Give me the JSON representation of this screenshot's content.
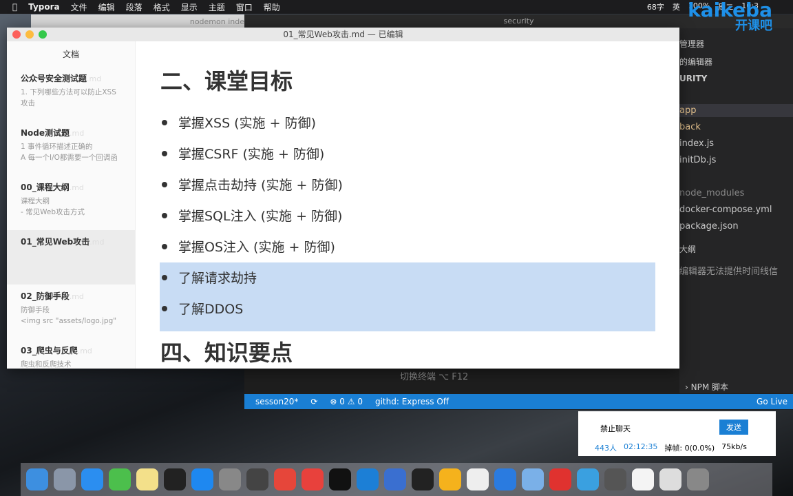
{
  "menubar": {
    "items": [
      "Typora",
      "文件",
      "编辑",
      "段落",
      "格式",
      "显示",
      "主题",
      "窗口",
      "帮助"
    ],
    "right": [
      "68字",
      "英",
      "100%",
      "周二",
      "10:3"
    ]
  },
  "brand": {
    "name": "kaikeba",
    "sub": "开课吧",
    "color": "#1e90e8"
  },
  "nodemon": {
    "title": "nodemon inde"
  },
  "vscode": {
    "title": "security",
    "explorer": [
      "管理器",
      "的编辑器",
      "URITY",
      "app",
      "back",
      "index.js",
      "initDb.js",
      "node_modules",
      "docker-compose.yml",
      "package.json",
      "大纲",
      "编辑器无法提供时间线信"
    ],
    "terminal_hint": "切换终端  ⌥ F12",
    "npm": "› NPM 脚本",
    "status": {
      "branch": "sesson20*",
      "problems": "⊗ 0 ⚠ 0",
      "githd": "githd: Express Off",
      "golive": "Go Live"
    }
  },
  "typora": {
    "title": "01_常见Web攻击.md — 已编辑",
    "sidebar_title": "文档",
    "docs": [
      {
        "name": "公众号安全测试题",
        "ext": ".md",
        "preview": [
          "1. 下列哪些方法可以防止XSS",
          "攻击"
        ]
      },
      {
        "name": "Node测试题",
        "ext": ".md",
        "preview": [
          "1 事件循环描述正确的",
          "A 每一个I/O都需要一个回调函"
        ]
      },
      {
        "name": "00_课程大纲",
        "ext": ".md",
        "preview": [
          "课程大纲",
          "- 常见Web攻击方式"
        ]
      },
      {
        "name": "01_常见Web攻击",
        "ext": ".md",
        "preview": [
          "",
          ""
        ]
      },
      {
        "name": "02_防御手段",
        "ext": ".md",
        "preview": [
          "防御手段",
          "<img src \"assets/logo.jpg\""
        ]
      },
      {
        "name": "03_爬虫与反爬",
        "ext": ".md",
        "preview": [
          "爬虫和反爬技术",
          ""
        ]
      }
    ],
    "heading1": "二、课堂目标",
    "bullets": [
      "掌握XSS (实施 + 防御)",
      "掌握CSRF (实施 + 防御)",
      "掌握点击劫持 (实施 + 防御)",
      "掌握SQL注入 (实施 + 防御)",
      "掌握OS注入 (实施 + 防御)",
      "了解请求劫持",
      "了解DDOS"
    ],
    "heading2": "四、知识要点",
    "selection_color": "#c8dcf4"
  },
  "chat": {
    "mute": "禁止聊天",
    "send": "发送",
    "viewers": "443人",
    "time": "02:12:35",
    "drop": "掉帧: 0(0.0%)",
    "rate": "75kb/s"
  }
}
